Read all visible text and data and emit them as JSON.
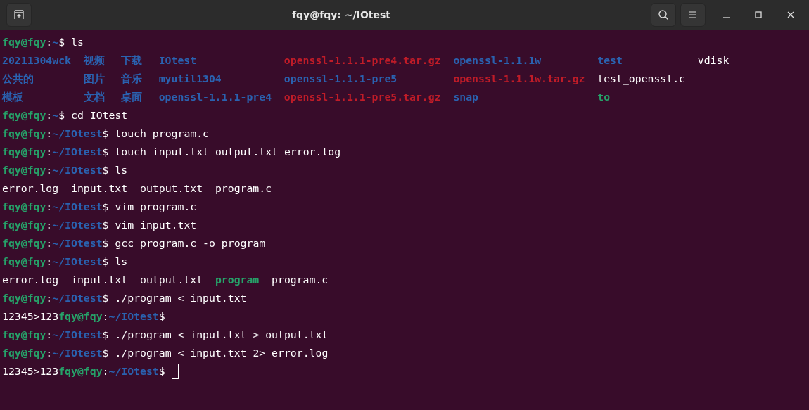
{
  "window": {
    "title": "fqy@fqy: ~/IOtest"
  },
  "lines": [
    {
      "kind": "prompt",
      "prompt": {
        "user": "fqy@fqy",
        "sep": ":",
        "path": "~",
        "end": "$"
      },
      "command": "ls"
    },
    {
      "kind": "listing",
      "columns": [
        [
          {
            "name": "20211304wck",
            "kind": "dir"
          },
          {
            "name": "公共的",
            "kind": "dir"
          },
          {
            "name": "模板",
            "kind": "dir"
          }
        ],
        [
          {
            "name": "视频",
            "kind": "dir"
          },
          {
            "name": "图片",
            "kind": "dir"
          },
          {
            "name": "文档",
            "kind": "dir"
          }
        ],
        [
          {
            "name": "下载",
            "kind": "dir"
          },
          {
            "name": "音乐",
            "kind": "dir"
          },
          {
            "name": "桌面",
            "kind": "dir"
          }
        ],
        [
          {
            "name": "IOtest",
            "kind": "dir"
          },
          {
            "name": "myutil1304",
            "kind": "dir"
          },
          {
            "name": "openssl-1.1.1-pre4",
            "kind": "dir"
          }
        ],
        [
          {
            "name": "openssl-1.1.1-pre4.tar.gz",
            "kind": "archive"
          },
          {
            "name": "openssl-1.1.1-pre5",
            "kind": "dir"
          },
          {
            "name": "openssl-1.1.1-pre5.tar.gz",
            "kind": "archive"
          }
        ],
        [
          {
            "name": "openssl-1.1.1w",
            "kind": "dir"
          },
          {
            "name": "openssl-1.1.1w.tar.gz",
            "kind": "archive"
          },
          {
            "name": "snap",
            "kind": "dir"
          }
        ],
        [
          {
            "name": "test",
            "kind": "dir"
          },
          {
            "name": "test_openssl.c",
            "kind": "file"
          },
          {
            "name": "to",
            "kind": "exec"
          }
        ],
        [
          {
            "name": "vdisk",
            "kind": "file"
          }
        ]
      ]
    },
    {
      "kind": "prompt",
      "prompt": {
        "user": "fqy@fqy",
        "sep": ":",
        "path": "~",
        "end": "$"
      },
      "command": "cd IOtest"
    },
    {
      "kind": "prompt",
      "prompt": {
        "user": "fqy@fqy",
        "sep": ":",
        "path": "~/IOtest",
        "end": "$"
      },
      "command": "touch program.c"
    },
    {
      "kind": "prompt",
      "prompt": {
        "user": "fqy@fqy",
        "sep": ":",
        "path": "~/IOtest",
        "end": "$"
      },
      "command": "touch input.txt output.txt error.log"
    },
    {
      "kind": "prompt",
      "prompt": {
        "user": "fqy@fqy",
        "sep": ":",
        "path": "~/IOtest",
        "end": "$"
      },
      "command": "ls"
    },
    {
      "kind": "files",
      "files": [
        {
          "name": "error.log",
          "kind": "file"
        },
        {
          "name": "input.txt",
          "kind": "file"
        },
        {
          "name": "output.txt",
          "kind": "file"
        },
        {
          "name": "program.c",
          "kind": "file"
        }
      ]
    },
    {
      "kind": "prompt",
      "prompt": {
        "user": "fqy@fqy",
        "sep": ":",
        "path": "~/IOtest",
        "end": "$"
      },
      "command": "vim program.c"
    },
    {
      "kind": "prompt",
      "prompt": {
        "user": "fqy@fqy",
        "sep": ":",
        "path": "~/IOtest",
        "end": "$"
      },
      "command": "vim input.txt"
    },
    {
      "kind": "prompt",
      "prompt": {
        "user": "fqy@fqy",
        "sep": ":",
        "path": "~/IOtest",
        "end": "$"
      },
      "command": "gcc program.c -o program"
    },
    {
      "kind": "prompt",
      "prompt": {
        "user": "fqy@fqy",
        "sep": ":",
        "path": "~/IOtest",
        "end": "$"
      },
      "command": "ls"
    },
    {
      "kind": "files",
      "files": [
        {
          "name": "error.log",
          "kind": "file"
        },
        {
          "name": "input.txt",
          "kind": "file"
        },
        {
          "name": "output.txt",
          "kind": "file"
        },
        {
          "name": "program",
          "kind": "exec"
        },
        {
          "name": "program.c",
          "kind": "file"
        }
      ]
    },
    {
      "kind": "prompt",
      "prompt": {
        "user": "fqy@fqy",
        "sep": ":",
        "path": "~/IOtest",
        "end": "$"
      },
      "command": "./program < input.txt"
    },
    {
      "kind": "prompt",
      "output": "12345>123",
      "prompt": {
        "user": "fqy@fqy",
        "sep": ":",
        "path": "~/IOtest",
        "end": "$"
      }
    },
    {
      "kind": "prompt",
      "prompt": {
        "user": "fqy@fqy",
        "sep": ":",
        "path": "~/IOtest",
        "end": "$"
      },
      "command": "./program < input.txt > output.txt"
    },
    {
      "kind": "prompt",
      "prompt": {
        "user": "fqy@fqy",
        "sep": ":",
        "path": "~/IOtest",
        "end": "$"
      },
      "command": "./program < input.txt 2> error.log"
    },
    {
      "kind": "prompt",
      "output": "12345>123",
      "prompt": {
        "user": "fqy@fqy",
        "sep": ":",
        "path": "~/IOtest",
        "end": "$"
      },
      "cursor": true
    }
  ]
}
